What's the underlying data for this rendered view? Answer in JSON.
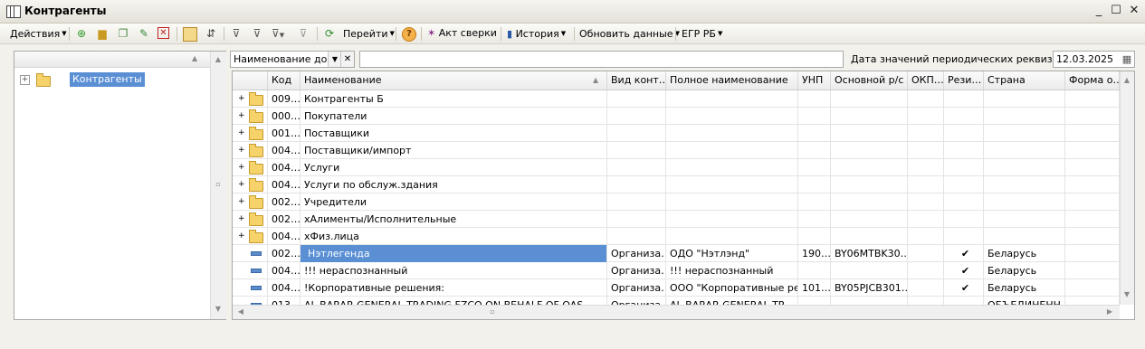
{
  "window": {
    "title": "Контрагенты",
    "minimize": "_",
    "maximize": "☐",
    "close": "✕"
  },
  "toolbar": {
    "actions_label": "Действия",
    "goto_label": "Перейти",
    "help_label": "?",
    "reconcile_label": "Акт сверки",
    "history_label": "История",
    "refresh_label": "Обновить данные",
    "egr_label": "ЕГР РБ"
  },
  "tree": {
    "root_label": "Контрагенты",
    "expand_symbol": "+"
  },
  "filter": {
    "combo_value": "Наименование догс",
    "date_label": "Дата значений периодических реквизитов:",
    "date_value": "12.03.2025"
  },
  "columns": [
    "Код",
    "Наименование",
    "Вид конт…",
    "Полное наименование",
    "УНП",
    "Основной р/с",
    "ОКП…",
    "Рези…",
    "Страна",
    "Форма о…"
  ],
  "rows": [
    {
      "kind": "group",
      "code": "009…",
      "name": "Контрагенты Б"
    },
    {
      "kind": "group",
      "code": "000…",
      "name": "Покупатели"
    },
    {
      "kind": "group",
      "code": "001…",
      "name": "Поставщики"
    },
    {
      "kind": "group",
      "code": "004…",
      "name": "Поставщики/импорт"
    },
    {
      "kind": "group",
      "code": "004…",
      "name": "Услуги"
    },
    {
      "kind": "group",
      "code": "004…",
      "name": "Услуги по обслуж.здания"
    },
    {
      "kind": "group",
      "code": "002…",
      "name": "Учредители"
    },
    {
      "kind": "group",
      "code": "002…",
      "name": "хАлименты/Исполнительные"
    },
    {
      "kind": "group",
      "code": "004…",
      "name": "хФиз.лица"
    },
    {
      "kind": "item",
      "code": "002…",
      "name": "Нэтлегенда",
      "type": "Организа…",
      "full": "ОДО \"Нэтлэнд\"",
      "unp": "190…",
      "account": "BY06MTBK30…",
      "okp": "",
      "resident": "✔",
      "country": "Беларусь",
      "form": "",
      "selected": true
    },
    {
      "kind": "item",
      "code": "004…",
      "name": "!!! нераспознанный",
      "type": "Организа…",
      "full": "!!! нераспознанный",
      "unp": "",
      "account": "",
      "okp": "",
      "resident": "✔",
      "country": "Беларусь",
      "form": ""
    },
    {
      "kind": "item",
      "code": "004…",
      "name": "!Корпоративные решения:",
      "type": "Организа…",
      "full": "ООО \"Корпоративные ре…",
      "unp": "101…",
      "account": "BY05PJCB301…",
      "okp": "",
      "resident": "✔",
      "country": "Беларусь",
      "form": ""
    },
    {
      "kind": "item",
      "code": "013…",
      "name": "AL BARAR GENERAL TRADING FZCO ON BEHALF OF OAS",
      "type": "Организа…",
      "full": "AL BARAR GENERAL TR…",
      "unp": "",
      "account": "",
      "okp": "",
      "resident": "",
      "country": "ОБЪЕДИНЕНН…",
      "form": ""
    }
  ]
}
